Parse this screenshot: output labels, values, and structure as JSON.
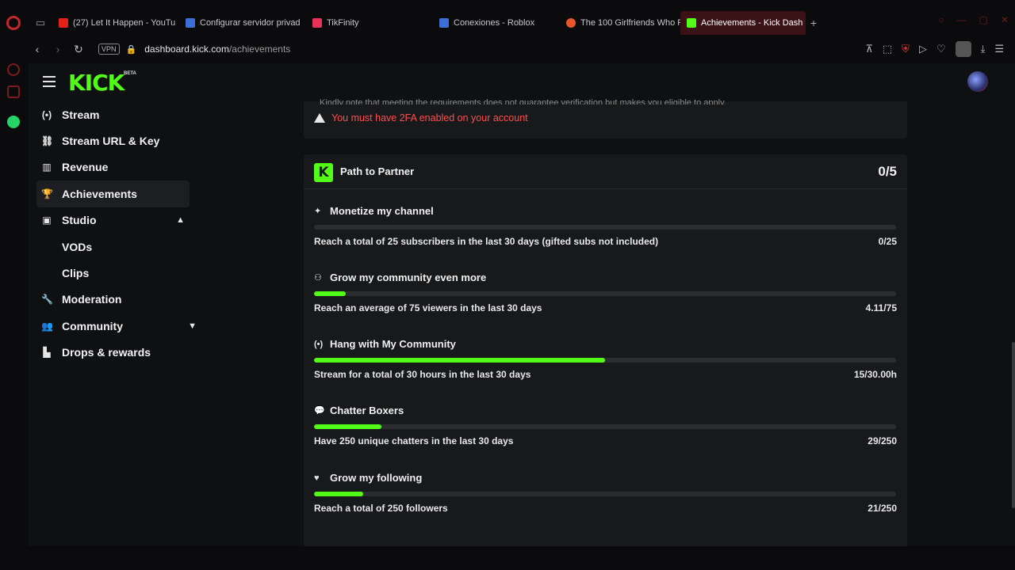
{
  "browser": {
    "tabs": [
      {
        "label": "(27) Let It Happen - YouTu",
        "color": "#e62117"
      },
      {
        "label": "Configurar servidor privad",
        "color": "#3c6fd8"
      },
      {
        "label": "TikFinity",
        "color": "#e8335a"
      },
      {
        "label": "Conexiones - Roblox",
        "color": "#3c6fd8"
      },
      {
        "label": "The 100 Girlfriends Who R",
        "color": "#e8562b"
      },
      {
        "label": "Achievements - Kick Dash",
        "color": "#53fc18"
      }
    ],
    "url_host": "dashboard.kick.com",
    "url_path": "/achievements",
    "vpn_label": "VPN"
  },
  "app": {
    "logo": "KICK",
    "beta": "BETA"
  },
  "sidebar": {
    "items": [
      {
        "label": "Stream",
        "icon": "broadcast-icon",
        "glyph": "(•)"
      },
      {
        "label": "Stream URL & Key",
        "icon": "link-icon",
        "glyph": "⛓"
      },
      {
        "label": "Revenue",
        "icon": "chart-icon",
        "glyph": "▥"
      },
      {
        "label": "Achievements",
        "icon": "trophy-icon",
        "glyph": "🏆"
      },
      {
        "label": "Studio",
        "icon": "studio-icon",
        "glyph": "▣"
      },
      {
        "label": "VODs"
      },
      {
        "label": "Clips"
      },
      {
        "label": "Moderation",
        "icon": "wrench-icon",
        "glyph": "🔧"
      },
      {
        "label": "Community",
        "icon": "users-icon",
        "glyph": "👥"
      },
      {
        "label": "Drops & rewards",
        "icon": "podium-icon",
        "glyph": "▙"
      }
    ]
  },
  "main": {
    "truncated_note": "Kindly note that meeting the requirements does not guarantee verification but makes you eligible to apply.",
    "warning": "You must have 2FA enabled on your account",
    "partner": {
      "badge": "K",
      "title": "Path to Partner",
      "count": "0/5",
      "achievements": [
        {
          "title": "Monetize my channel",
          "icon": "sparkle-icon",
          "glyph": "✦",
          "requirement": "Reach a total of 25 subscribers in the last 30 days (gifted subs not included)",
          "progress": "0/25",
          "fraction": 0
        },
        {
          "title": "Grow my community even more",
          "icon": "people-icon",
          "glyph": "⚇",
          "requirement": "Reach an average of 75 viewers in the last 30 days",
          "progress": "4.11/75",
          "fraction": 0.055
        },
        {
          "title": "Hang with My Community",
          "icon": "broadcast-icon",
          "glyph": "(•)",
          "requirement": "Stream for a total of 30 hours in the last 30 days",
          "progress": "15/30.00h",
          "fraction": 0.5
        },
        {
          "title": "Chatter Boxers",
          "icon": "chat-icon",
          "glyph": "💬",
          "requirement": "Have 250 unique chatters in the last 30 days",
          "progress": "29/250",
          "fraction": 0.116
        },
        {
          "title": "Grow my following",
          "icon": "heart-icon",
          "glyph": "♥",
          "requirement": "Reach a total of 250 followers",
          "progress": "21/250",
          "fraction": 0.084
        }
      ]
    }
  }
}
